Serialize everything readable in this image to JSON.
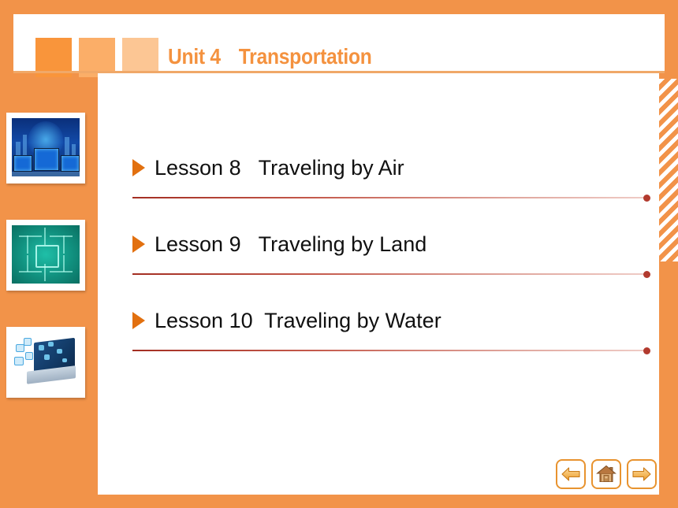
{
  "slide": {
    "background_color": "#F29349",
    "panel_color": "#ffffff"
  },
  "header": {
    "unit_label": "Unit 4",
    "title": "Transportation",
    "title_color": "#F4923F",
    "squares": [
      {
        "name": "square-dark",
        "color": "#F9953B"
      },
      {
        "name": "square-medium",
        "color": "#FBAE68"
      },
      {
        "name": "square-light",
        "color": "#FCC694"
      }
    ]
  },
  "thumbnails": [
    {
      "name": "thumbnail-monitors",
      "alt": "blue monitors over city skyline"
    },
    {
      "name": "thumbnail-circuit",
      "alt": "teal circuit board"
    },
    {
      "name": "thumbnail-laptop",
      "alt": "laptop with floating app icons"
    }
  ],
  "lessons": [
    {
      "number": "Lesson 8",
      "title": "Traveling by Air",
      "text": "Lesson 8   Traveling by Air"
    },
    {
      "number": "Lesson 9",
      "title": "Traveling by Land",
      "text": "Lesson 9   Traveling by Land"
    },
    {
      "number": "Lesson 10",
      "title": "Traveling by Water",
      "text": "Lesson 10  Traveling by Water"
    }
  ],
  "decoration": {
    "bullet_color": "#E2700F",
    "divider_color": "#A32E22",
    "divider_dot_color": "#B23A2E",
    "stripe_color": "#F29349"
  },
  "navigation": {
    "back": "back-arrow",
    "home": "home",
    "forward": "forward-arrow",
    "border_color": "#E8932F"
  }
}
